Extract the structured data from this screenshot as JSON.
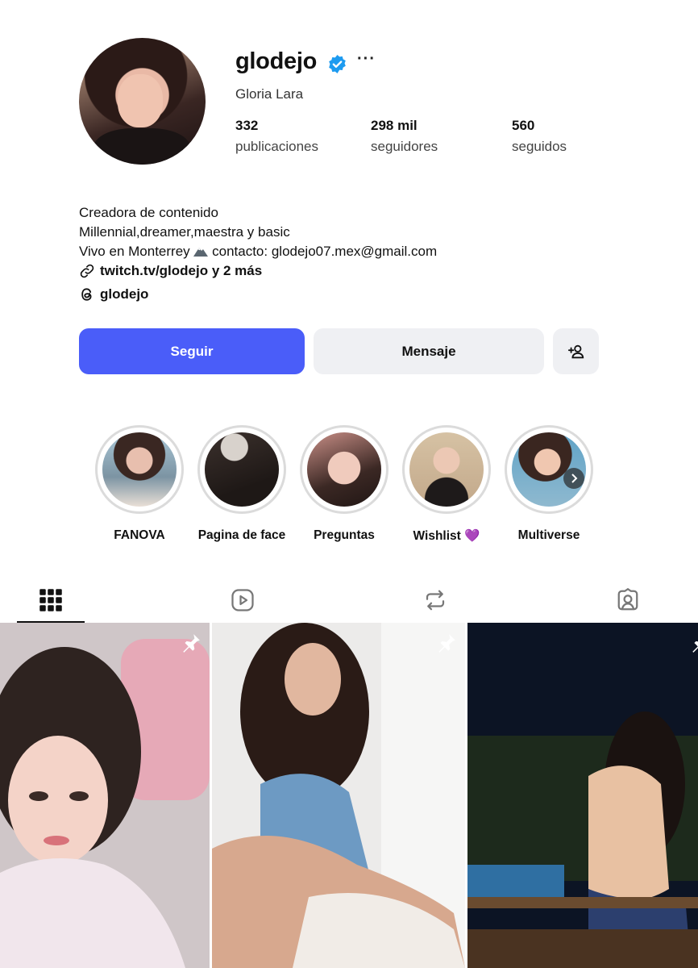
{
  "profile": {
    "username": "glodejo",
    "full_name": "Gloria Lara",
    "more": "···",
    "stats": [
      {
        "value": "332",
        "label": "publicaciones"
      },
      {
        "value": "298 mil",
        "label": "seguidores"
      },
      {
        "value": "560",
        "label": "seguidos"
      }
    ],
    "bio": {
      "line1": "Creadora de contenido",
      "line2": "Millennial,dreamer,maestra y basic",
      "line3_prefix": "Vivo en Monterrey",
      "line3_suffix": "contacto: glodejo07.mex@gmail.com",
      "link": "twitch.tv/glodejo y 2 más",
      "threads": "glodejo"
    }
  },
  "actions": {
    "follow": "Seguir",
    "message": "Mensaje"
  },
  "highlights": [
    {
      "label": "FANOVA",
      "bg": "#cfd8dd"
    },
    {
      "label": "Pagina de face",
      "bg": "#4a3f3a"
    },
    {
      "label": "Preguntas",
      "bg": "#b89a8d"
    },
    {
      "label": "Wishlist 💜",
      "bg": "#d7c3ab"
    },
    {
      "label": "Multiverse",
      "bg": "#9ab7c9"
    }
  ],
  "tabs": [
    "posts-grid-icon",
    "reels-icon",
    "reposts-icon",
    "tagged-icon"
  ],
  "colors": {
    "accent": "#4a5df9",
    "verified": "#1d9bf0",
    "secondary_button": "#eff0f3"
  }
}
